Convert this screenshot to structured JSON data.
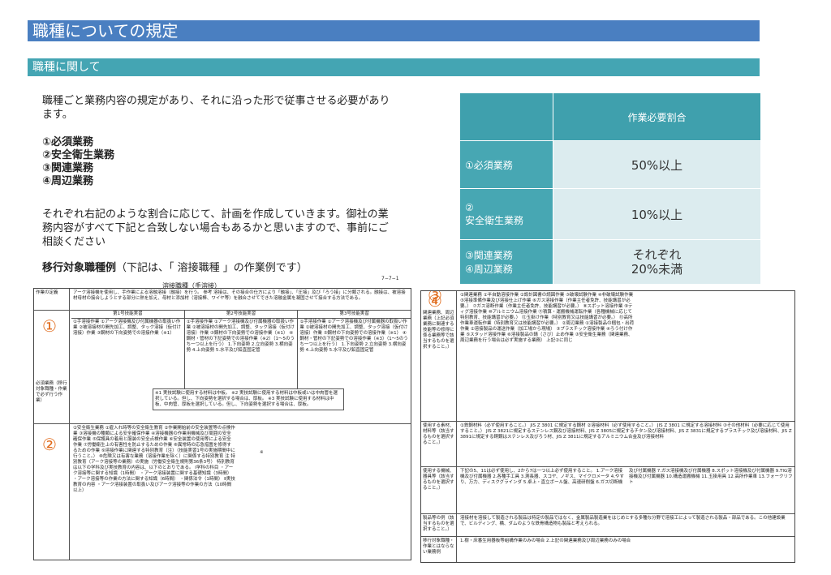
{
  "header": {
    "title": "職種についての規定",
    "section": "職種に関して"
  },
  "intro": {
    "line": "職種ごと業務内容の規定があり、それに沿った形で従事させる必要があります。"
  },
  "duties": [
    "①必須業務",
    "②安全衛生業務",
    "③関連業務",
    "④周辺業務"
  ],
  "paragraph": "それぞれ右記のような割合に応じて、計画を作成していきます。御社の業務内容がすべて下記と合致しない場合もあるかと思いますので、事前にご相談ください",
  "example": {
    "bold": "移行対象職種例",
    "rest": "（下記は、「 溶接職種 」の作業例です）"
  },
  "ratio_table": {
    "header": "作業必要割合",
    "rows": [
      {
        "label": "①必須業務",
        "value": "50%以上"
      },
      {
        "label": "②\n安全衛生業務",
        "value": "10%以上"
      },
      {
        "label": "③関連業務\n④周辺業務",
        "value": "それぞれ\n20%未満"
      }
    ]
  },
  "doc1": {
    "page_no": "7−7−1",
    "title": "溶接職種（手溶接）",
    "def_label": "作業の定義",
    "def_text": "アーク溶接機を使用し、手作業による溶融溶接（融接）を行う。 参考 溶接は、その接合の仕方により「融接」、「圧接」及び「ろう接」に分類される。融接は、被溶接材母材の接合しようとする部分に熱を加え、母材と添加材（溶接棒、ワイヤ等）を融合させてできた溶融金属を凝固させて接合する方法である。",
    "grades": [
      "第1号技能実習",
      "第2号技能実習",
      "第3号技能実習"
    ],
    "circle1": "①",
    "circle2": "②",
    "mandatory_label": "必須業務（移行対象職種・作業で必ず行う作業）",
    "g1": "①手溶接作業 ①アーク溶接機及び付属機器の取扱い作業 ②被溶接材の開先加工、調整、タック溶接（仮付け溶接）作業 ③鋼材の下向姿勢での溶接作業（※1）",
    "g2": "①手溶接作業 ①アーク溶接機及び付属機器の取扱い作業 ②被溶接材の開先加工、調整、タック溶接（仮付け溶接）作業 ③鋼材の下向姿勢での溶接作業（※1） ④鋼材・管材の下記姿勢での溶接作業（※2）（1〜5のうち一つ以上を行う） 1.下向姿勢 2.立向姿勢 3.横向姿勢 4.上向姿勢 5.水平及び鉛直固定管",
    "g3": "①手溶接作業 ①アーク溶接機及び付属機器の取扱い作業 ②被溶接材の開先加工、調整、タック溶接（仮付け溶接）作業 ③鋼材の下向姿勢での溶接作業（※1） ④鋼材・管材の下記姿勢での溶接作業（※3）（1〜5のうち一つ以上を行う） 1.下向姿勢 2.立向姿勢 3.横向姿勢 4.上向姿勢 5.水平及び鉛直固定管",
    "notes": "※1 実技試験に使用する材料は中板。 ※2 実技試験に使用する材料は中板或いは中肉管を選択している。但し、下向姿勢を選択する場合は、厚板。 ※3 実技試験に使用する材料は中板、中肉管、厚板を選択している。但し、下向姿勢を選択する場合は、厚板。",
    "safety": "②安全衛生業務 ①雇入れ時等の安全衛生教育 ②作業開始前の安全装置等の点検作業 ③溶接機の種類による安全確保作業 ④溶接機器の作業用機械及び周囲の安全確保作業 ⑤保護具の着用と服装の安全点検作業 ⑥安全装置の使用等による安全作業 ⑦労働衛生上の有害性を防止するための作業 ⑧異常時の応急措置を修得するための作業 ⑨溶接作業に関連する特別教育（注）（技能実習1号の実施期間中に行うこと。） ⑩危険又は有害な業務（溶接作業を除く）に関係する特別教育 注 特別教育（アーク溶接等の業務）の実施（労働安全衛生規則第36条3号） 特別教育は以下の学科及び実技教育の内容は、以下のとおりである。 Ⅰ学科の科目 ・アーク溶接等に関する知識（1時間） ・アーク溶接装置に関する基礎知識（3時間） ・アーク溶接等の作業の方法に関する知識（6時間） ・関係法令（1時間） Ⅱ実技教育の内容 ・アーク溶接装置の取扱い及びアーク溶接等の作業の方法（10時間以上）",
    "mark": "※"
  },
  "doc2": {
    "circle3": "③",
    "circle4": "④",
    "related_label": "関連業務、周辺業務（上記必須業務に関連する技能等の修得に係る業務等で該当するものを選択すること。）",
    "related": "①関連業務 ①半自動溶接作業 ②設計図書の読図作業 ③破壊試験作業 ④非破壊試験作業 ⑤溶接準備作業及び溶接仕上げ作業 ⑥ガス溶接作業（作業主任者免許、技能講習が必要。） ⑦ガス溶断作業（作業主任者免許、技能講習が必要。） ⑧スポット溶接作業 ⑨ティグ溶接作業 ⑩アルミニウム溶接作業 ⑪積算・運搬機械運転作業（各種機械に応じて特別教育、技能講習が必要。） ⑫玉掛け作業（特別教育又は技能講習が必要。） ⑬高所作業車運転作業（特別教育又は技能講習が必要。） ②周辺業務 ①溶接製品の梱包・出荷作業 ②溶接製品の運送作業（加工場から現場） ③プラスチック溶接作業 ④ろう付け作業 ⑤スタッド溶接作業 ⑥溶接製品の錆（さび）止め作業 ③安全衛生業務（関連業務、周辺業務を行う場合は必ず実施する業務） 上記②に同じ",
    "material_label": "使用する素材、材料等（該当するものを選択すること。）",
    "material": "①鉄鋼材料（必ず使用すること。） JIS Z 3801 に規定する鋼材 ②溶接材料（必ず使用すること。） JIS Z 3801 に規定する溶接材料 ③その他材料（必要に応じて使用すること。） JIS Z 3821に規定するステンレス鋼及び溶接材料、JIS Z 3805に規定するチタン及び溶接材料、JIS Z 3831に規定するプラスチック及び溶接材料、JIS Z 3891に規定する銅鋼はステンレス及びろう材、JIS Z 3811に規定するアルミニウム合金及び溶接材料",
    "equipment_label": "使用する機械、器具等（該当するものを選択すること。）",
    "equipment": "下記の5、11は必ず使用し、2から7は一つ以上必ず使用すること。 1.アーク溶接機及び付属機器 2.各種手工具 3.測長器、スコヤ、ノギス、マイクロメータ 4.やすり、万力、ディスクグラインダ 5.卓上・直立ボール盤、高速研削盤 6.ガス切断機及び付属機器 7.ガス溶接機及び付属機器 8.スポット溶接機及び付属機器 9.TIG溶接機及び付属機器 10.構造運搬機械 11.玉掛用具 12.高所作業車 13.フォークリフト",
    "products_label": "製品等の例（該当するものを選択すること。）",
    "products": "溶接材を溶接して製造される製品は特定の製品ではなく、金属製品製造業をはじめとする多種な分野で溶接工によって製造される製品・部品である。この他建設業で、ビルディング、橋、ダムのような鉄骨構造物も製品と考えられる。",
    "target_label": "移行対象職種・作業とはならない業務例",
    "target": "1.樹・床番生用器板等組構作業のみの場合 2.上記の関連業務及び周辺業務のみの場合"
  }
}
